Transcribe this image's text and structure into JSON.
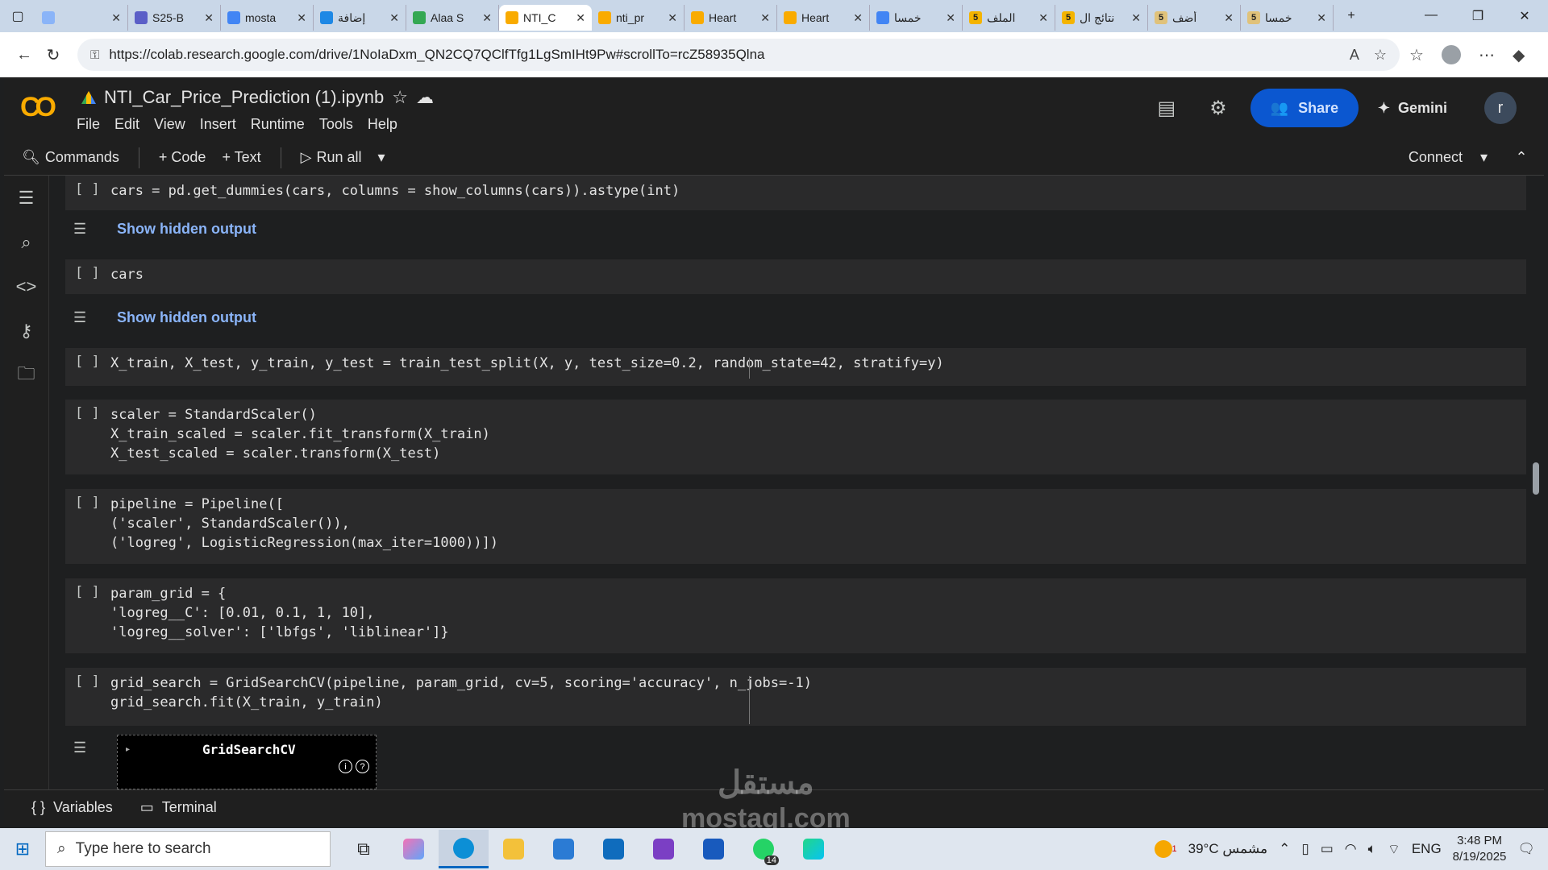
{
  "browser": {
    "tabs": [
      {
        "title": "",
        "favicon_color": "#8ab4f8",
        "active": false
      },
      {
        "title": "S25-B",
        "favicon_color": "#5b5fc7",
        "active": false
      },
      {
        "title": "mosta",
        "favicon_color": "#4285f4",
        "active": false
      },
      {
        "title": "إضافة",
        "favicon_color": "#1e88e5",
        "active": false
      },
      {
        "title": "Alaa S",
        "favicon_color": "#34a853",
        "active": false
      },
      {
        "title": "NTI_C",
        "favicon_color": "#f9ab00",
        "active": true
      },
      {
        "title": "nti_pr",
        "favicon_color": "#f9ab00",
        "active": false
      },
      {
        "title": "Heart",
        "favicon_color": "#f9ab00",
        "active": false
      },
      {
        "title": "Heart",
        "favicon_color": "#f9ab00",
        "active": false
      },
      {
        "title": "خمسا",
        "favicon_color": "#4285f4",
        "active": false
      },
      {
        "title": "الملف",
        "favicon_color": "#f4b400",
        "badge": "5",
        "active": false
      },
      {
        "title": "نتائج ال",
        "favicon_color": "#f4b400",
        "badge": "5",
        "active": false
      },
      {
        "title": "أضف",
        "favicon_color": "#e0c27a",
        "badge": "5",
        "active": false
      },
      {
        "title": "خمسا",
        "favicon_color": "#e0c27a",
        "badge": "5",
        "active": false
      }
    ],
    "url": "https://colab.research.google.com/drive/1NoIaDxm_QN2CQ7QClfTfg1LgSmIHt9Pw#scrollTo=rcZ58935Qlna"
  },
  "colab": {
    "logo": "CO",
    "notebook_title": "NTI_Car_Price_Prediction (1).ipynb",
    "menu": [
      "File",
      "Edit",
      "View",
      "Insert",
      "Runtime",
      "Tools",
      "Help"
    ],
    "share_label": "Share",
    "gemini_label": "Gemini",
    "avatar_initial": "r",
    "toolbar": {
      "commands": "Commands",
      "add_code": "+ Code",
      "add_text": "+ Text",
      "run_all": "Run all",
      "connect": "Connect"
    },
    "accent_color": "#0b57d0"
  },
  "cells": [
    {
      "bracket": "[ ]",
      "lines": [
        "cars = pd.get_dummies(cars, columns = show_columns(cars)).astype(int)"
      ],
      "output": "Show hidden output"
    },
    {
      "bracket": "[ ]",
      "lines": [
        "cars"
      ],
      "output": "Show hidden output"
    },
    {
      "bracket": "[ ]",
      "lines": [
        "X_train, X_test, y_train, y_test = train_test_split(X, y, test_size=0.2, random_state=42, stratify=y)"
      ]
    },
    {
      "bracket": "[ ]",
      "lines": [
        "scaler = StandardScaler()",
        "X_train_scaled = scaler.fit_transform(X_train)",
        "X_test_scaled = scaler.transform(X_test)"
      ]
    },
    {
      "bracket": "[ ]",
      "lines": [
        "pipeline = Pipeline([",
        "('scaler', StandardScaler()),",
        "('logreg', LogisticRegression(max_iter=1000))])"
      ]
    },
    {
      "bracket": "[ ]",
      "lines": [
        "param_grid = {",
        "'logreg__C': [0.01, 0.1, 1, 10],",
        "'logreg__solver': ['lbfgs', 'liblinear']}"
      ]
    },
    {
      "bracket": "[ ]",
      "lines": [
        "grid_search = GridSearchCV(pipeline, param_grid, cv=5, scoring='accuracy', n_jobs=-1)",
        "grid_search.fit(X_train, y_train)"
      ],
      "widget_title": "GridSearchCV"
    }
  ],
  "statusbar": {
    "variables": "Variables",
    "terminal": "Terminal"
  },
  "watermark": {
    "line1": "مستقل",
    "line2": "mostaql.com"
  },
  "taskbar": {
    "search_placeholder": "Type here to search",
    "whatsapp_badge": "14",
    "weather_badge": "1",
    "weather": "39°C مشمس",
    "language": "ENG",
    "time": "3:48 PM",
    "date": "8/19/2025"
  }
}
